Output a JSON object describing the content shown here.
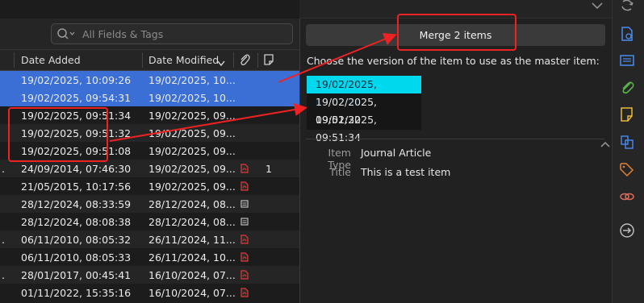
{
  "search": {
    "placeholder": "All Fields & Tags"
  },
  "columns": {
    "date_added": "Date Added",
    "date_modified": "Date Modified"
  },
  "rows": [
    {
      "lead": "",
      "added": "19/02/2025, 10:09:26",
      "modified": "19/02/2025, 10...",
      "attachment": "",
      "count": "",
      "style": "selected"
    },
    {
      "lead": "",
      "added": "19/02/2025, 09:54:31",
      "modified": "19/02/2025, 10...",
      "attachment": "",
      "count": "",
      "style": "selected"
    },
    {
      "lead": "",
      "added": "19/02/2025, 09:51:34",
      "modified": "19/02/2025, 09...",
      "attachment": "",
      "count": "",
      "style": "plain"
    },
    {
      "lead": "",
      "added": "19/02/2025, 09:51:32",
      "modified": "19/02/2025, 09...",
      "attachment": "",
      "count": "",
      "style": "alt"
    },
    {
      "lead": "",
      "added": "19/02/2025, 09:51:08",
      "modified": "19/02/2025, 09...",
      "attachment": "",
      "count": "",
      "style": "plain"
    },
    {
      "lead": ".",
      "added": "24/09/2014, 07:46:30",
      "modified": "19/02/2025, 09...",
      "attachment": "pdf-icon",
      "count": "1",
      "style": "alt"
    },
    {
      "lead": "",
      "added": "21/05/2015, 10:17:56",
      "modified": "19/02/2025, 09...",
      "attachment": "pdf-icon",
      "count": "",
      "style": "plain"
    },
    {
      "lead": "",
      "added": "28/12/2024, 08:33:59",
      "modified": "28/12/2024, 08...",
      "attachment": "snapshot-icon",
      "count": "",
      "style": "alt"
    },
    {
      "lead": "",
      "added": "28/12/2024, 08:08:38",
      "modified": "28/12/2024, 08...",
      "attachment": "snapshot-icon",
      "count": "",
      "style": "plain"
    },
    {
      "lead": ".",
      "added": "06/11/2010, 08:05:32",
      "modified": "26/11/2024, 11...",
      "attachment": "pdf-icon",
      "count": "",
      "style": "alt"
    },
    {
      "lead": "",
      "added": "06/11/2010, 08:05:33",
      "modified": "26/11/2024, 10...",
      "attachment": "pdf-icon",
      "count": "",
      "style": "plain"
    },
    {
      "lead": ".",
      "added": "28/01/2017, 00:45:41",
      "modified": "16/10/2024, 07...",
      "attachment": "pdf-icon",
      "count": "",
      "style": "alt"
    },
    {
      "lead": "",
      "added": "01/11/2022, 15:35:16",
      "modified": "16/10/2024, 07...",
      "attachment": "pdf-icon",
      "count": "",
      "style": "plain"
    }
  ],
  "merge": {
    "button_label": "Merge 2 items",
    "instruction": "Choose the version of the item to use as the master item:",
    "versions": [
      "19/02/2025, 09:51:08",
      "19/02/2025, 09:51:32",
      "19/02/2025, 09:51:34"
    ],
    "selected_version_index": 0
  },
  "metadata": {
    "item_type_label": "Item Type",
    "item_type_value": "Journal Article",
    "title_label": "Title",
    "title_value": "This is a test item"
  },
  "sidebar_icons": [
    "sync-icon",
    "info-icon",
    "abstract-icon",
    "attachments-icon",
    "notes-icon",
    "libraries-collections-icon",
    "tags-icon",
    "related-icon",
    "locate-icon"
  ],
  "colors": {
    "selection": "#3b6fd6",
    "active_version": "#00d8ee",
    "annotation": "#ee2222"
  }
}
